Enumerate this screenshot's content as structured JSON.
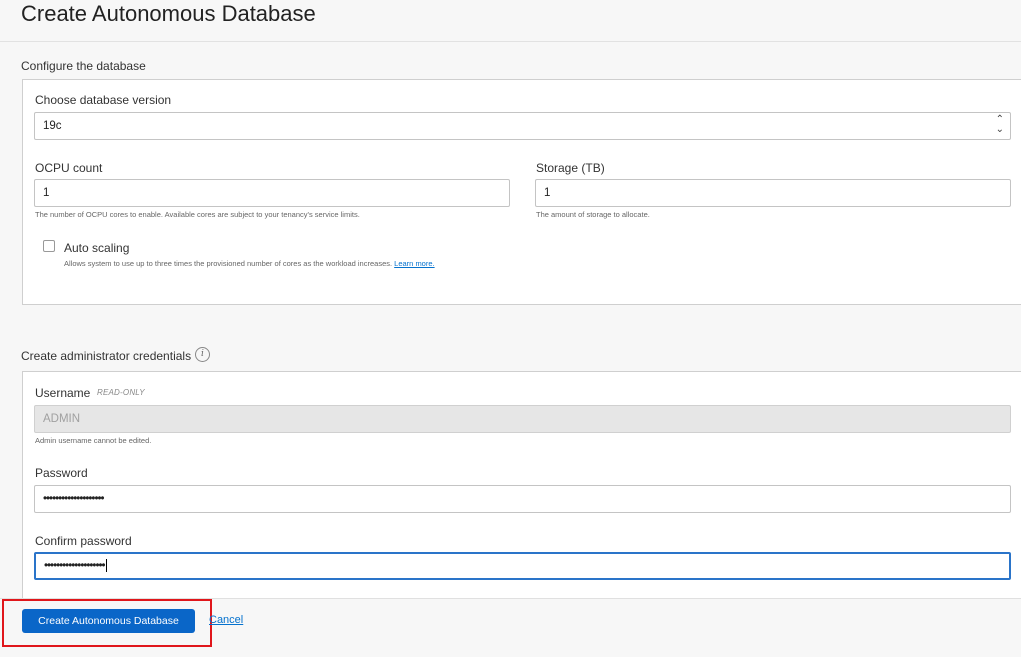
{
  "page": {
    "title": "Create Autonomous Database"
  },
  "configure": {
    "section_title": "Configure the database",
    "version_label": "Choose database version",
    "version_value": "19c",
    "ocpu_label": "OCPU count",
    "ocpu_value": "1",
    "ocpu_help": "The number of OCPU cores to enable. Available cores are subject to your tenancy's service limits.",
    "storage_label": "Storage (TB)",
    "storage_value": "1",
    "storage_help": "The amount of storage to allocate.",
    "autoscale_label": "Auto scaling",
    "autoscale_checked": false,
    "autoscale_help": "Allows system to use up to three times the provisioned number of cores as the workload increases.",
    "learn_more": "Learn more."
  },
  "credentials": {
    "section_title": "Create administrator credentials",
    "info_icon": "i",
    "username_label": "Username",
    "readonly_tag": "READ-ONLY",
    "username_value": "ADMIN",
    "username_help": "Admin username cannot be edited.",
    "password_label": "Password",
    "password_value": "••••••••••••••••••••",
    "confirm_label": "Confirm password",
    "confirm_value": "••••••••••••••••••••"
  },
  "footer": {
    "create_button": "Create Autonomous Database",
    "cancel_link": "Cancel"
  },
  "colors": {
    "primary": "#0a66c8",
    "highlight": "#e0161b",
    "link": "#0572ce"
  }
}
